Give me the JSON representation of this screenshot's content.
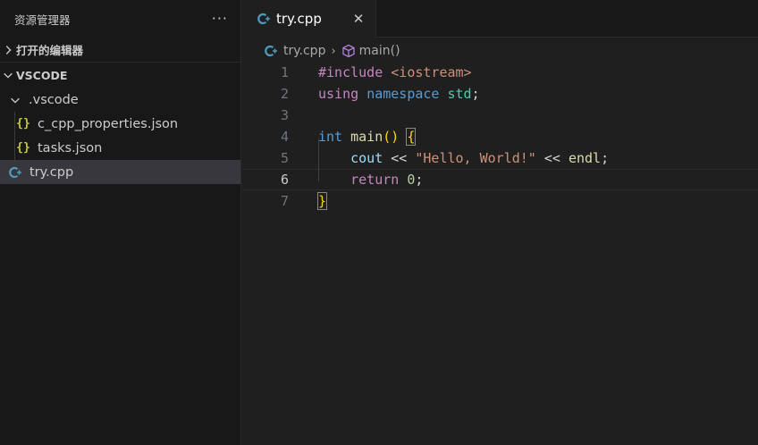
{
  "sidebar": {
    "title": "资源管理器",
    "more_label": "···",
    "open_editors_label": "打开的编辑器",
    "workspace_label": "VSCODE",
    "folder": {
      "name": ".vscode",
      "files": [
        {
          "name": "c_cpp_properties.json",
          "icon": "{}"
        },
        {
          "name": "tasks.json",
          "icon": "{}"
        }
      ]
    },
    "root_file": {
      "name": "try.cpp"
    }
  },
  "tabs": [
    {
      "label": "try.cpp",
      "close": "✕"
    }
  ],
  "breadcrumb": {
    "file": "try.cpp",
    "separator": "›",
    "symbol": "main()"
  },
  "code": {
    "line_numbers": [
      "1",
      "2",
      "3",
      "4",
      "5",
      "6",
      "7"
    ],
    "current_line": 6
  },
  "colors": {
    "accent_json": "#cbcb41",
    "accent_cpp": "#519aba",
    "symbol_purple": "#b180d7"
  }
}
